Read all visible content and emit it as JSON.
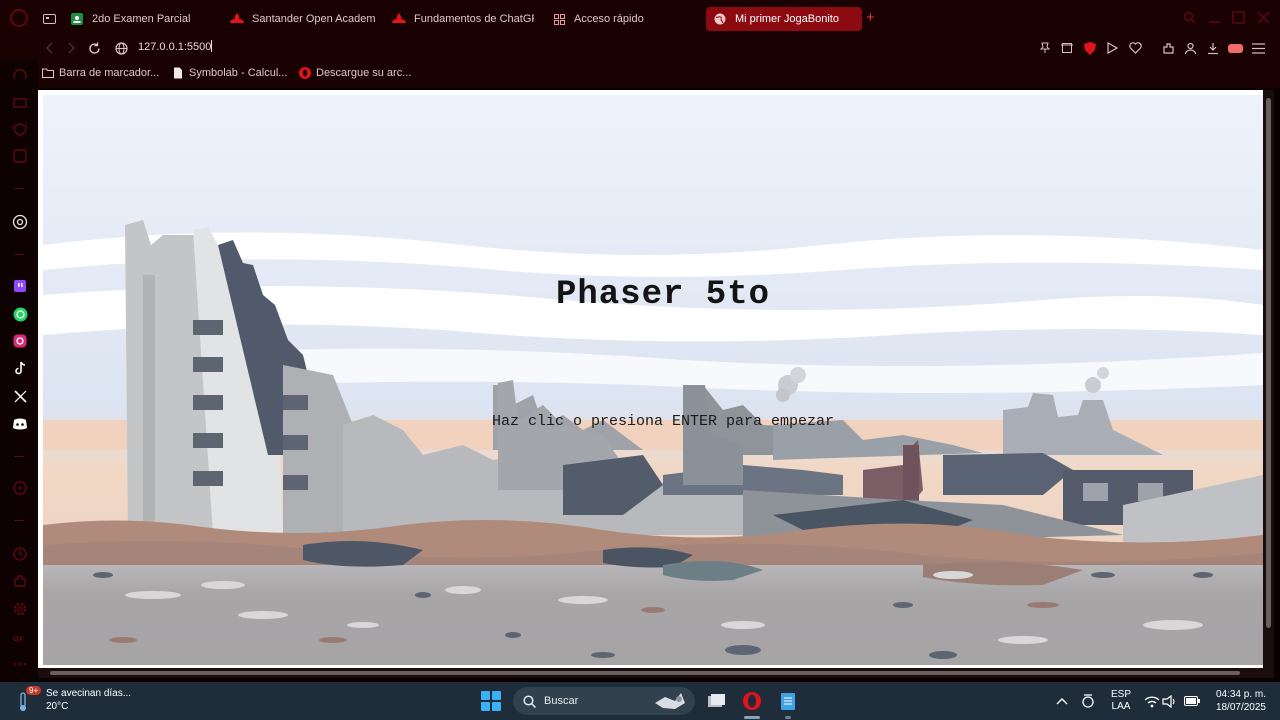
{
  "browser": {
    "tabs": [
      {
        "label": "2do Examen Parcial",
        "icon": "google-classroom-icon",
        "active": false
      },
      {
        "label": "Santander Open Academ",
        "icon": "santander-flame-icon",
        "active": false
      },
      {
        "label": "Fundamentos de ChatGP",
        "icon": "santander-flame-icon",
        "active": false
      },
      {
        "label": "Acceso rápido",
        "icon": "grid-icon",
        "active": false
      },
      {
        "label": "Mi primer JogaBonito",
        "icon": "globe-icon",
        "active": true
      }
    ],
    "new_tab_glyph": "+",
    "url": "127.0.0.1:5500",
    "bookmarks": [
      {
        "label": "Barra de marcador...",
        "icon": "folder-icon"
      },
      {
        "label": "Symbolab - Calcul...",
        "icon": "document-icon"
      },
      {
        "label": "Descargue su arc...",
        "icon": "opera-red-icon"
      }
    ]
  },
  "game": {
    "title": "Phaser 5to",
    "subtitle": "Haz clic o presiona ENTER para empezar"
  },
  "taskbar": {
    "weather_title": "Se avecinan días...",
    "weather_temp": "20°C",
    "weather_badge": "9+",
    "search_label": "Buscar",
    "language_top": "ESP",
    "language_bottom": "LAA",
    "time": "04:34 p. m.",
    "date": "18/07/2025"
  },
  "colors": {
    "browser_bg": "#1a0203",
    "accent_red": "#8b0b10",
    "taskbar_bg": "#1f2d3a",
    "windows_blue": "#3ab1f5"
  }
}
